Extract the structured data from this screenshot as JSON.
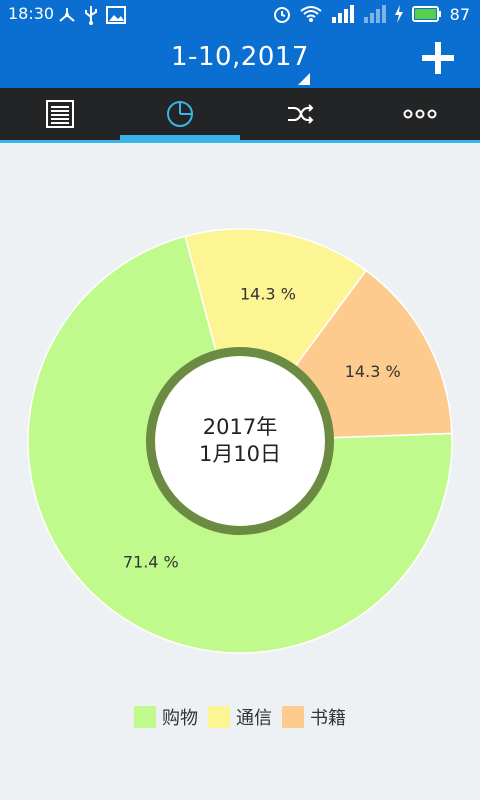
{
  "status_bar": {
    "time": "18:30",
    "battery": "87",
    "network_type": "4G"
  },
  "header": {
    "title": "1-10,2017",
    "add_icon": "plus-icon"
  },
  "tabs": [
    {
      "name": "list",
      "icon": "list-icon"
    },
    {
      "name": "chart",
      "icon": "pie-chart-icon",
      "active": true
    },
    {
      "name": "shuffle",
      "icon": "shuffle-icon"
    },
    {
      "name": "more",
      "icon": "more-icon"
    }
  ],
  "center_label": {
    "line1": "2017年",
    "line2": "1月10日"
  },
  "colors": {
    "brand": "#0a6fd1",
    "tabbar": "#222426",
    "accent": "#39b4e6",
    "center_ring": "#6b8b43"
  },
  "chart_data": {
    "type": "pie",
    "title": "",
    "categories": [
      "购物",
      "通信",
      "书籍"
    ],
    "values": [
      71.4,
      14.3,
      14.3
    ],
    "labels": [
      "71.4 %",
      "14.3 %",
      "14.3 %"
    ],
    "colors": [
      "#c1fa8c",
      "#fdf493",
      "#fdcb8d"
    ],
    "legend": "bottom"
  }
}
